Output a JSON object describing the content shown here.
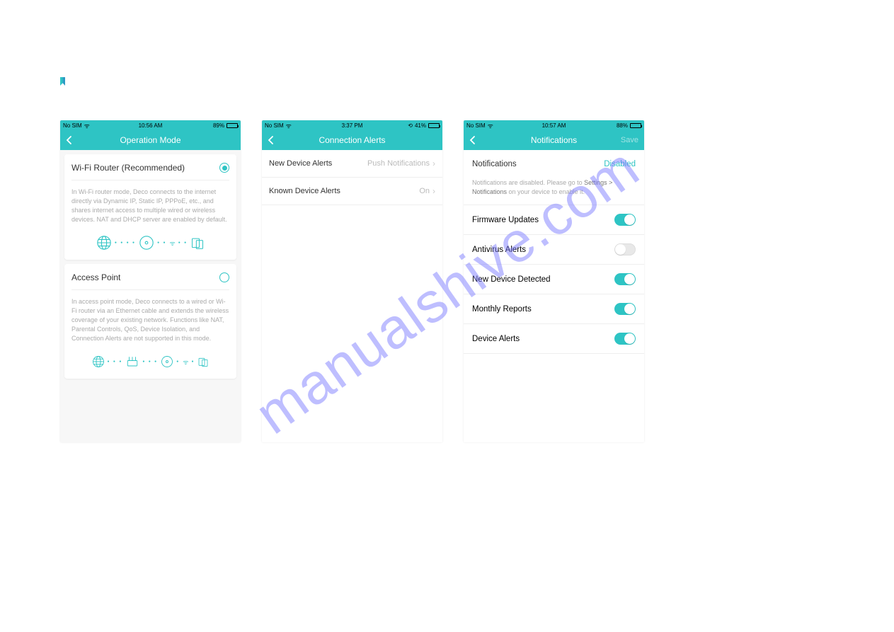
{
  "watermark": "manualshive.com",
  "phone1": {
    "status": {
      "carrier": "No SIM",
      "time": "10:56 AM",
      "battery_pct": "89%",
      "battery_fill": 89,
      "low": false
    },
    "title": "Operation Mode",
    "card1": {
      "title": "Wi-Fi Router (Recommended)",
      "selected": true,
      "desc": "In Wi-Fi router mode, Deco connects to the internet directly via Dynamic IP, Static IP, PPPoE, etc., and shares internet access to multiple wired or wireless devices. NAT and DHCP server are enabled by default."
    },
    "card2": {
      "title": "Access Point",
      "selected": false,
      "desc": "In access point mode, Deco connects to a wired or Wi-Fi router via an Ethernet cable and extends the wireless coverage of your existing network. Functions like NAT, Parental Controls, QoS, Device Isolation, and Connection Alerts are not supported in this mode."
    }
  },
  "phone2": {
    "status": {
      "carrier": "No SIM",
      "time": "3:37 PM",
      "battery_pct": "41%",
      "battery_fill": 41,
      "low": true,
      "orientation_lock": true
    },
    "title": "Connection Alerts",
    "rows": [
      {
        "label": "New Device Alerts",
        "value": "Push Notifications"
      },
      {
        "label": "Known Device Alerts",
        "value": "On"
      }
    ]
  },
  "phone3": {
    "status": {
      "carrier": "No SIM",
      "time": "10:57 AM",
      "battery_pct": "88%",
      "battery_fill": 88,
      "low": false
    },
    "title": "Notifications",
    "save_label": "Save",
    "status_row": {
      "label": "Notifications",
      "value": "Disabled"
    },
    "note_pre": "Notifications are disabled. Please go to ",
    "note_strong": "Settings > Notifications",
    "note_post": " on your device to enable it.",
    "toggles": [
      {
        "label": "Firmware Updates",
        "on": true
      },
      {
        "label": "Antivirus Alerts",
        "on": false
      },
      {
        "label": "New Device Detected",
        "on": true
      },
      {
        "label": "Monthly Reports",
        "on": true
      },
      {
        "label": "Device Alerts",
        "on": true
      }
    ]
  }
}
